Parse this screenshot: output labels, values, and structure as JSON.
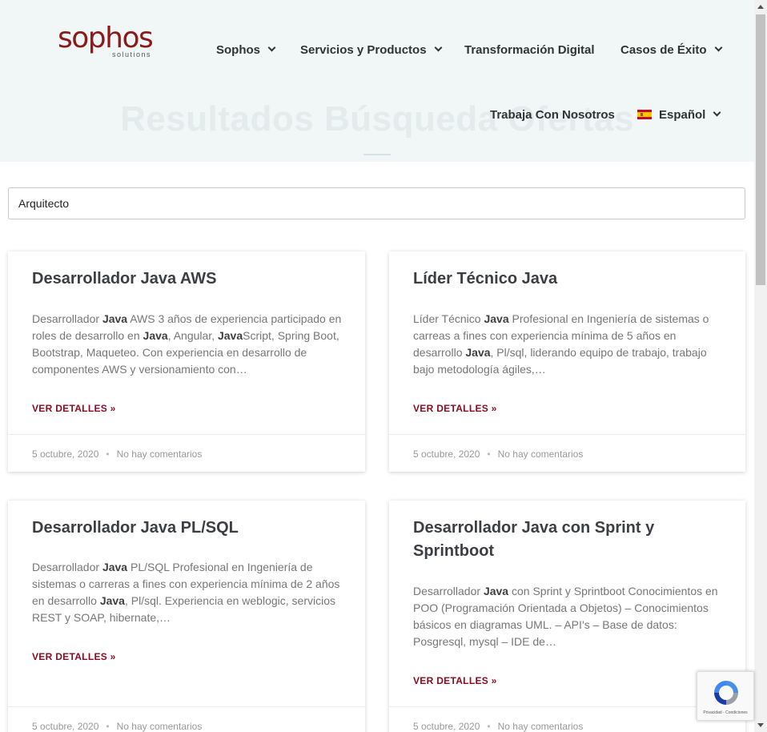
{
  "header": {
    "logo": {
      "name": "sophos",
      "tagline": "solutions"
    },
    "nav": [
      {
        "label": "Sophos",
        "has_dropdown": true
      },
      {
        "label": "Servicios y Productos",
        "has_dropdown": true
      },
      {
        "label": "Transformación Digital",
        "has_dropdown": false
      },
      {
        "label": "Casos de Éxito",
        "has_dropdown": true
      },
      {
        "label": "Trabaja Con Nosotros",
        "has_dropdown": false
      },
      {
        "label": "Español",
        "has_dropdown": true,
        "icon": "spain-flag-icon"
      }
    ]
  },
  "hero": {
    "title": "Resultados Búsqueda Ofertas"
  },
  "search": {
    "value": "Arquitecto"
  },
  "cards": [
    {
      "title": "Desarrollador Java AWS",
      "excerpt_html": "Desarrollador <b>Java</b> AWS 3 años de experiencia participado en roles de desarrollo en <b>Java</b>, Angular, <b>Java</b>Script, Spring Boot, Bootstrap, Maqueteo. Con experiencia en desarrollo de componentes AWS y versionamiento con…",
      "link": "VER DETALLES »",
      "date": "5 octubre, 2020",
      "comments": "No hay comentarios"
    },
    {
      "title": "Líder Técnico Java",
      "excerpt_html": "Líder Técnico <b>Java</b> Profesional en Ingeniería de sistemas o carreas a fines con experiencia mínima de 5 años en desarrollo <b>Java</b>, Pl/sql, liderando equipo de trabajo, trabajo bajo metodología ágiles,…",
      "link": "VER DETALLES »",
      "date": "5 octubre, 2020",
      "comments": "No hay comentarios"
    },
    {
      "title": "Desarrollador Java PL/SQL",
      "excerpt_html": "Desarrollador <b>Java</b> PL/SQL Profesional en Ingeniería de sistemas o carreras a fines con experiencia mínima de 2 años en desarrollo <b>Java</b>, Pl/sql. Experiencia en weblogic, servicios REST y SOAP, hibernate,…",
      "link": "VER DETALLES »",
      "date": "5 octubre, 2020",
      "comments": "No hay comentarios"
    },
    {
      "title": "Desarrollador Java con Sprint y Sprintboot",
      "excerpt_html": "Desarrollador <b>Java</b> con Sprint y Sprintboot Conocimientos en POO (Programación Orientada a Objetos) – Conocimientos básicos en diagramas UML. – API’s – Base de datos: Posgresql, mysql – IDE de…",
      "link": "VER DETALLES »",
      "date": "5 octubre, 2020",
      "comments": "No hay comentarios"
    }
  ],
  "recaptcha": {
    "text": "Privacidad - Condiciones"
  },
  "colors": {
    "accent": "#8b0a1e",
    "hero_bg": "#f1f6f7",
    "nav_text": "#2f3337"
  }
}
